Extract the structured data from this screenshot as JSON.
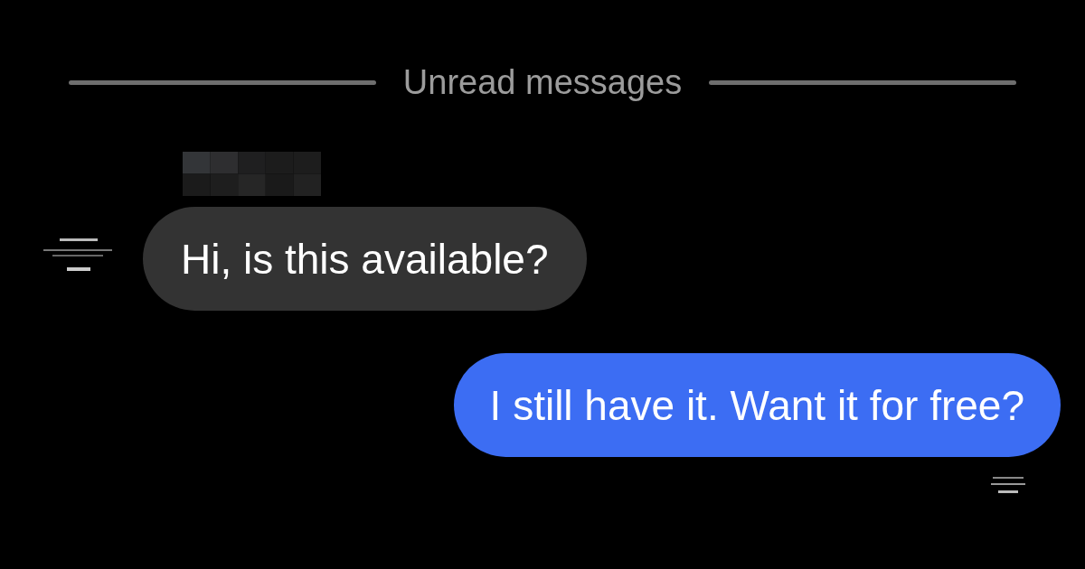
{
  "divider": {
    "label": "Unread messages"
  },
  "messages": [
    {
      "kind": "incoming",
      "text": "Hi, is this available?"
    },
    {
      "kind": "outgoing",
      "text": "I still have it. Want it for free?"
    }
  ]
}
